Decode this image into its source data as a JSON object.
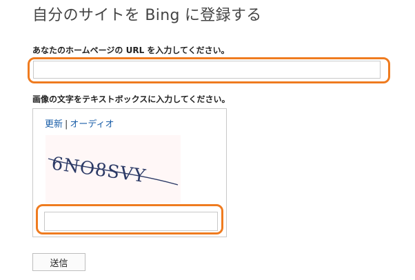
{
  "page": {
    "title": "自分のサイトを Bing に登録する"
  },
  "url_field": {
    "label": "あなたのホームページの URL を入力してください。",
    "value": "",
    "placeholder": ""
  },
  "captcha": {
    "label": "画像の文字をテキストボックスに入力してください。",
    "refresh_link": "更新",
    "separator": "|",
    "audio_link": "オーディオ",
    "image_text": "6NO8SVY",
    "value": "",
    "placeholder": ""
  },
  "actions": {
    "submit_label": "送信"
  },
  "colors": {
    "highlight": "#ef7b1f",
    "link": "#1a5ea8"
  }
}
